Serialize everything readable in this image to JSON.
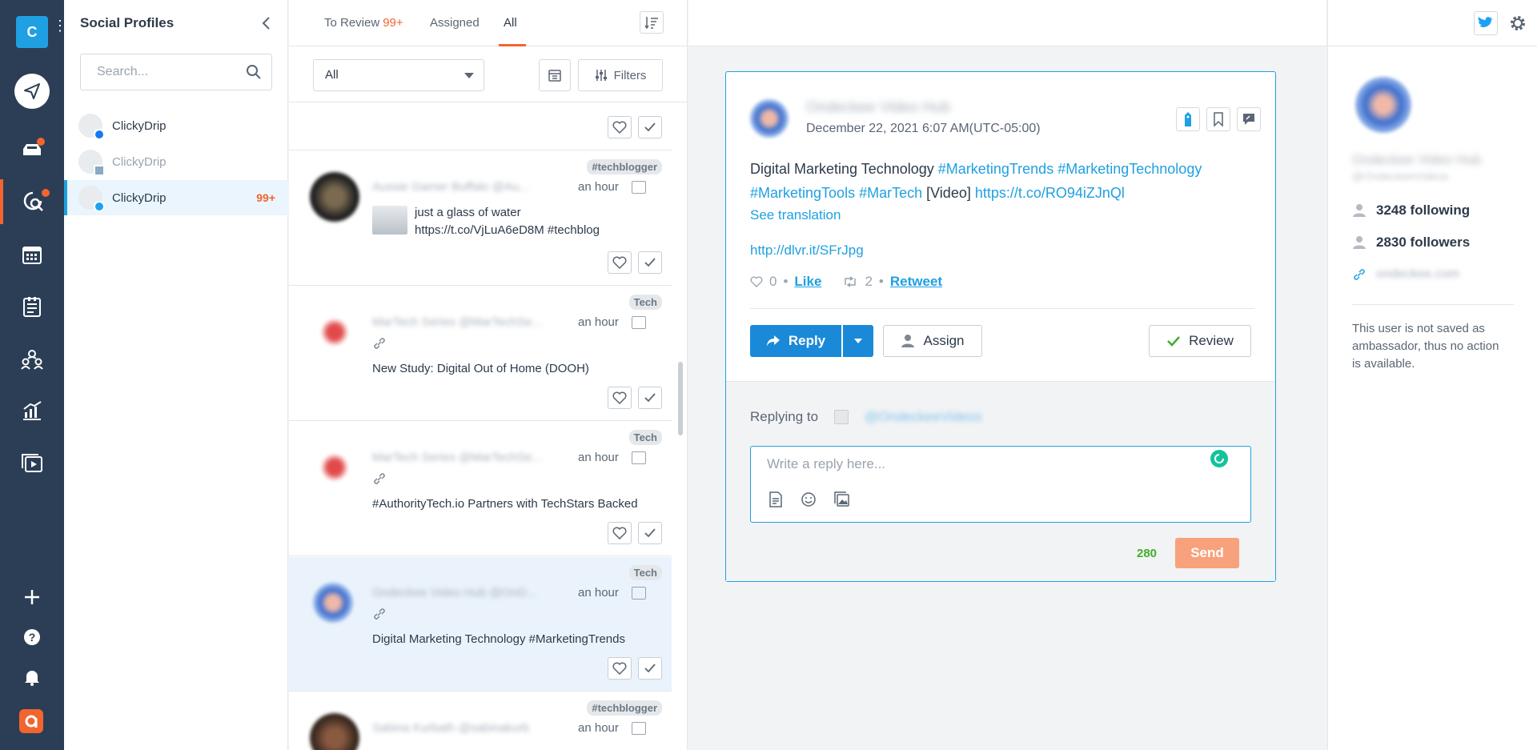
{
  "rail": {
    "logo_letter": "C",
    "items": [
      "publish",
      "inbox",
      "listening",
      "calendar",
      "planner",
      "team",
      "analytics",
      "media"
    ]
  },
  "profiles": {
    "title": "Social Profiles",
    "search_placeholder": "Search...",
    "items": [
      {
        "name": "ClickyDrip",
        "network": "facebook",
        "count": ""
      },
      {
        "name": "ClickyDrip",
        "network": "linkedin",
        "count": ""
      },
      {
        "name": "ClickyDrip",
        "network": "twitter",
        "count": "99+"
      }
    ]
  },
  "list": {
    "tabs": [
      {
        "label": "To Review",
        "count": "99+"
      },
      {
        "label": "Assigned",
        "count": ""
      },
      {
        "label": "All",
        "count": ""
      }
    ],
    "filter_select": "All",
    "filters_label": "Filters",
    "messages": [
      {
        "tag": "#techblogger",
        "name": "Aussie Gamer Buffalo @Au...",
        "time": "an hour",
        "text1": "just a glass of water",
        "text2": "https://t.co/VjLuA6eD8M #techblog"
      },
      {
        "tag": "Tech",
        "name": "MarTech Series @MarTechSe...",
        "time": "an hour",
        "text1": "New Study: Digital Out of Home (DOOH)",
        "text2": ""
      },
      {
        "tag": "Tech",
        "name": "MarTech Series @MarTechSe...",
        "time": "an hour",
        "text1": "#AuthorityTech.io Partners with TechStars Backed",
        "text2": ""
      },
      {
        "tag": "Tech",
        "name": "Ondeckee Video Hub @OnD...",
        "time": "an hour",
        "text1": "Digital Marketing Technology #MarketingTrends",
        "text2": ""
      },
      {
        "tag": "#techblogger",
        "name": "Sabina Kurbath @sabinakurb",
        "time": "an hour",
        "text1": "",
        "text2": ""
      }
    ]
  },
  "post": {
    "author": "Ondeckee Video Hub",
    "date": "December 22, 2021 6:07 AM(UTC-05:00)",
    "body_plain": "Digital Marketing Technology ",
    "tags": [
      "#MarketingTrends",
      "#MarketingTechnology",
      "#MarketingTools",
      "#MarTech"
    ],
    "video_label": "[Video]",
    "link": "https://t.co/RO94iZJnQl",
    "see_translation": "See translation",
    "short_url": "http://dlvr.it/SFrJpg",
    "likes": "0",
    "like_label": "Like",
    "retweets": "2",
    "retweet_label": "Retweet",
    "reply_label": "Reply",
    "assign_label": "Assign",
    "review_label": "Review",
    "replying_to_label": "Replying to",
    "replying_handle": "@OndeckeeVideos",
    "reply_placeholder": "Write a reply here...",
    "char_count": "280",
    "send_label": "Send"
  },
  "user": {
    "name": "Ondeckee Video Hub",
    "handle": "@OndeckeeVideos",
    "following": "3248 following",
    "followers": "2830 followers",
    "website": "ondeckee.com",
    "note": "This user is not saved as ambassador, thus no action is available."
  },
  "colors": {
    "accent": "#1fa0e2",
    "brand_orange": "#f26430",
    "rail": "#2c3e55",
    "send": "#f7a27c"
  }
}
